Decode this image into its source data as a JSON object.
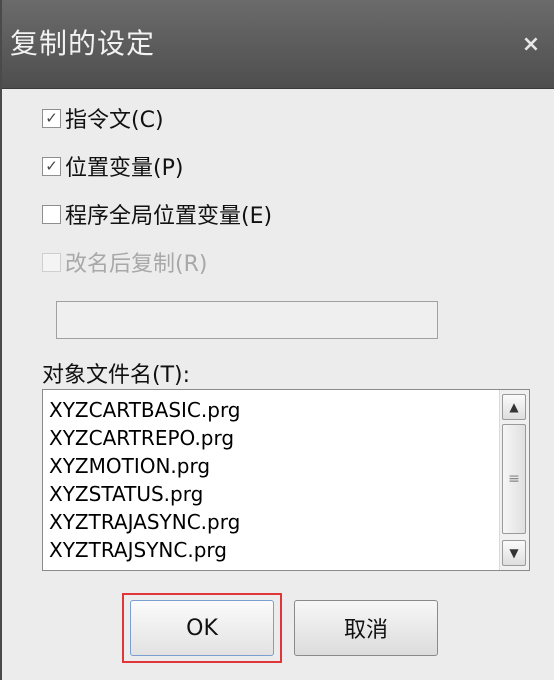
{
  "window": {
    "title": "复制的设定",
    "close_glyph": "×"
  },
  "options": [
    {
      "label": "指令文(C)",
      "checked": true,
      "disabled": false
    },
    {
      "label": "位置变量(P)",
      "checked": true,
      "disabled": false
    },
    {
      "label": "程序全局位置变量(E)",
      "checked": false,
      "disabled": false
    },
    {
      "label": "改名后复制(R)",
      "checked": false,
      "disabled": true
    }
  ],
  "rename": {
    "value": ""
  },
  "file_list": {
    "label": "对象文件名(T):",
    "items": [
      "XYZCARTBASIC.prg",
      "XYZCARTREPO.prg",
      "XYZMOTION.prg",
      "XYZSTATUS.prg",
      "XYZTRAJASYNC.prg",
      "XYZTRAJSYNC.prg"
    ]
  },
  "buttons": {
    "ok": "OK",
    "cancel": "取消"
  },
  "icons": {
    "check": "check-icon",
    "close": "close-icon",
    "scroll_up": "arrow-up-icon",
    "scroll_down": "arrow-down-icon",
    "grip": "grip-icon"
  },
  "colors": {
    "title_bar": "#5a5a5a",
    "focus_border": "#e0353b"
  }
}
